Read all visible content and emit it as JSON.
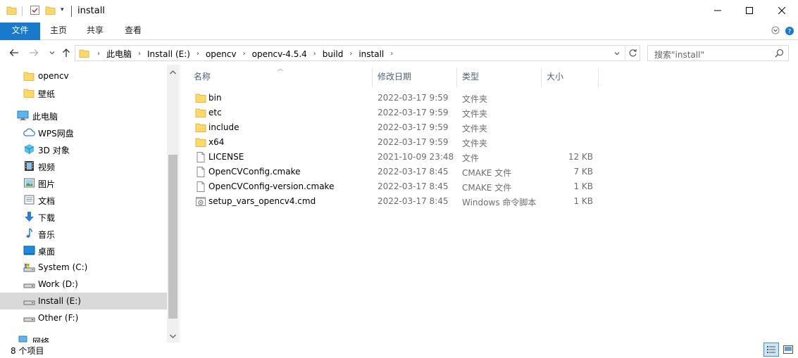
{
  "window": {
    "title": "install",
    "minimize_icon": "minimize-icon",
    "maximize_icon": "maximize-icon",
    "close_icon": "close-icon"
  },
  "ribbon": {
    "tabs": [
      {
        "label": "文件"
      },
      {
        "label": "主页"
      },
      {
        "label": "共享"
      },
      {
        "label": "查看"
      }
    ]
  },
  "address": {
    "crumbs": [
      "此电脑",
      "Install (E:)",
      "opencv",
      "opencv-4.5.4",
      "build",
      "install"
    ],
    "search_placeholder": "搜索\"install\""
  },
  "navpane": {
    "items": [
      {
        "label": "opencv",
        "icon": "folder-icon"
      },
      {
        "label": "壁纸",
        "icon": "folder-icon"
      },
      {
        "label": "此电脑",
        "icon": "computer-icon"
      },
      {
        "label": "WPS网盘",
        "icon": "cloud-icon"
      },
      {
        "label": "3D 对象",
        "icon": "cube-3d-icon"
      },
      {
        "label": "视频",
        "icon": "video-icon"
      },
      {
        "label": "图片",
        "icon": "pictures-icon"
      },
      {
        "label": "文档",
        "icon": "documents-icon"
      },
      {
        "label": "下载",
        "icon": "download-icon"
      },
      {
        "label": "音乐",
        "icon": "music-icon"
      },
      {
        "label": "桌面",
        "icon": "desktop-icon"
      },
      {
        "label": "System (C:)",
        "icon": "drive-icon"
      },
      {
        "label": "Work (D:)",
        "icon": "drive-icon"
      },
      {
        "label": "Install (E:)",
        "icon": "drive-icon"
      },
      {
        "label": "Other (F:)",
        "icon": "drive-icon"
      },
      {
        "label": "网络",
        "icon": "network-icon"
      }
    ]
  },
  "filelist": {
    "columns": {
      "name": "名称",
      "date": "修改日期",
      "type": "类型",
      "size": "大小"
    },
    "rows": [
      {
        "name": "bin",
        "date": "2022-03-17 9:59",
        "type": "文件夹",
        "size": "",
        "icon": "folder-icon"
      },
      {
        "name": "etc",
        "date": "2022-03-17 9:59",
        "type": "文件夹",
        "size": "",
        "icon": "folder-icon"
      },
      {
        "name": "include",
        "date": "2022-03-17 9:59",
        "type": "文件夹",
        "size": "",
        "icon": "folder-icon"
      },
      {
        "name": "x64",
        "date": "2022-03-17 9:59",
        "type": "文件夹",
        "size": "",
        "icon": "folder-icon"
      },
      {
        "name": "LICENSE",
        "date": "2021-10-09 23:48",
        "type": "文件",
        "size": "12 KB",
        "icon": "file-icon"
      },
      {
        "name": "OpenCVConfig.cmake",
        "date": "2022-03-17 8:45",
        "type": "CMAKE 文件",
        "size": "7 KB",
        "icon": "file-icon"
      },
      {
        "name": "OpenCVConfig-version.cmake",
        "date": "2022-03-17 8:45",
        "type": "CMAKE 文件",
        "size": "1 KB",
        "icon": "file-icon"
      },
      {
        "name": "setup_vars_opencv4.cmd",
        "date": "2022-03-17 8:45",
        "type": "Windows 命令脚本",
        "size": "1 KB",
        "icon": "cmd-file-icon"
      }
    ]
  },
  "status": {
    "item_count": "8 个项目"
  },
  "colors": {
    "accent": "#1979ca",
    "folder": "#ffd868",
    "selected_nav": "#d9d9d9"
  }
}
